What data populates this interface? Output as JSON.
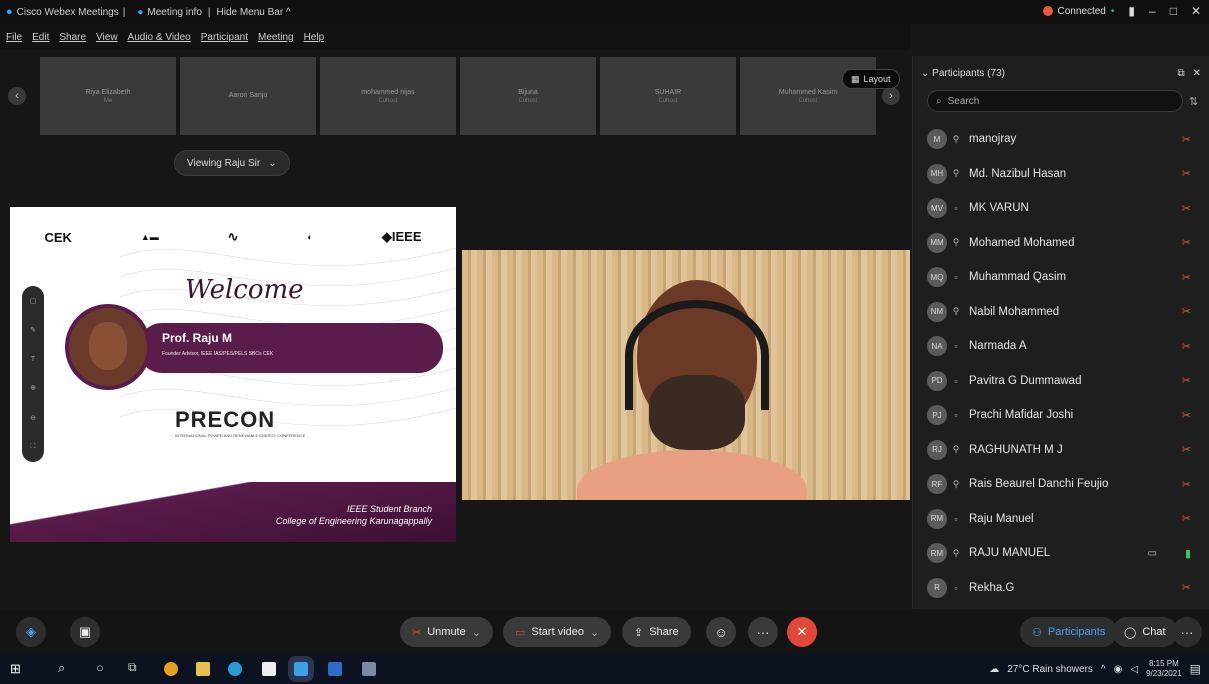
{
  "titlebar": {
    "app": "Cisco Webex Meetings",
    "sep1": "|",
    "meeting_info": "Meeting info",
    "sep2": "|",
    "hide_menu": "Hide Menu Bar ^",
    "connected": "Connected",
    "minimize": "–",
    "maximize": "□",
    "close": "✕"
  },
  "menu": [
    "File",
    "Edit",
    "Share",
    "View",
    "Audio & Video",
    "Participant",
    "Meeting",
    "Help"
  ],
  "thumbnails": [
    {
      "name": "Riya Elizabeth",
      "sub": "Me"
    },
    {
      "name": "Aaron Sanju",
      "sub": ""
    },
    {
      "name": "mohammed nijas",
      "sub": "Cohost"
    },
    {
      "name": "Bijuna",
      "sub": "Cohost"
    },
    {
      "name": "SUHAIR",
      "sub": "Cohost"
    },
    {
      "name": "Muhammed Kasim",
      "sub": "Cohost"
    }
  ],
  "layout_label": "Layout",
  "viewing_label": "Viewing Raju Sir",
  "slide": {
    "logos": [
      "CEK",
      "IEEE"
    ],
    "welcome": "Welcome",
    "name": "Prof. Raju M",
    "role": "Founder Advisor, IEEE IAS/PES/PELS SBCs CEK",
    "precon": "PRECON",
    "precon_sub": "INTERNATIONAL POWER AND RENEWABLE ENERGY CONFERENCE",
    "footer1": "IEEE Student Branch",
    "footer2": "College of Engineering Karunagappally"
  },
  "participants": {
    "header": "Participants (73)",
    "search_placeholder": "Search",
    "list": [
      {
        "initials": "M",
        "name": "manojray",
        "device": "mobile",
        "mic": "muted"
      },
      {
        "initials": "MH",
        "name": "Md. Nazibul Hasan",
        "device": "mobile",
        "mic": "muted"
      },
      {
        "initials": "MV",
        "name": "MK VARUN",
        "device": "desktop",
        "mic": "muted"
      },
      {
        "initials": "MM",
        "name": "Mohamed Mohamed",
        "device": "mobile",
        "mic": "muted"
      },
      {
        "initials": "MQ",
        "name": "Muhammad Qasim",
        "device": "desktop",
        "mic": "muted"
      },
      {
        "initials": "NM",
        "name": "Nabil Mohammed",
        "device": "mobile",
        "mic": "muted"
      },
      {
        "initials": "NA",
        "name": "Narmada A",
        "device": "desktop",
        "mic": "muted"
      },
      {
        "initials": "PD",
        "name": "Pavitra G Dummawad",
        "device": "desktop",
        "mic": "muted"
      },
      {
        "initials": "PJ",
        "name": "Prachi Mafidar Joshi",
        "device": "desktop",
        "mic": "muted"
      },
      {
        "initials": "RJ",
        "name": "RAGHUNATH M J",
        "device": "mobile",
        "mic": "muted"
      },
      {
        "initials": "RF",
        "name": "Rais Beaurel Danchi Feujio",
        "device": "mobile",
        "mic": "muted"
      },
      {
        "initials": "RM",
        "name": "Raju Manuel",
        "device": "desktop",
        "mic": "muted"
      },
      {
        "initials": "RM",
        "name": "RAJU MANUEL",
        "device": "mobile",
        "mic": "on"
      },
      {
        "initials": "R",
        "name": "Rekha.G",
        "device": "desktop",
        "mic": "muted"
      }
    ]
  },
  "controls": {
    "unmute": "Unmute",
    "start_video": "Start video",
    "share": "Share",
    "participants": "Participants",
    "chat": "Chat",
    "more": "···"
  },
  "taskbar": {
    "weather": "27°C Rain showers",
    "time": "8:15 PM",
    "date": "9/23/2021"
  },
  "colors": {
    "accent_red": "#e0483a",
    "slide_purple": "#5a1c4b",
    "connected_dot": "#e8583a"
  }
}
